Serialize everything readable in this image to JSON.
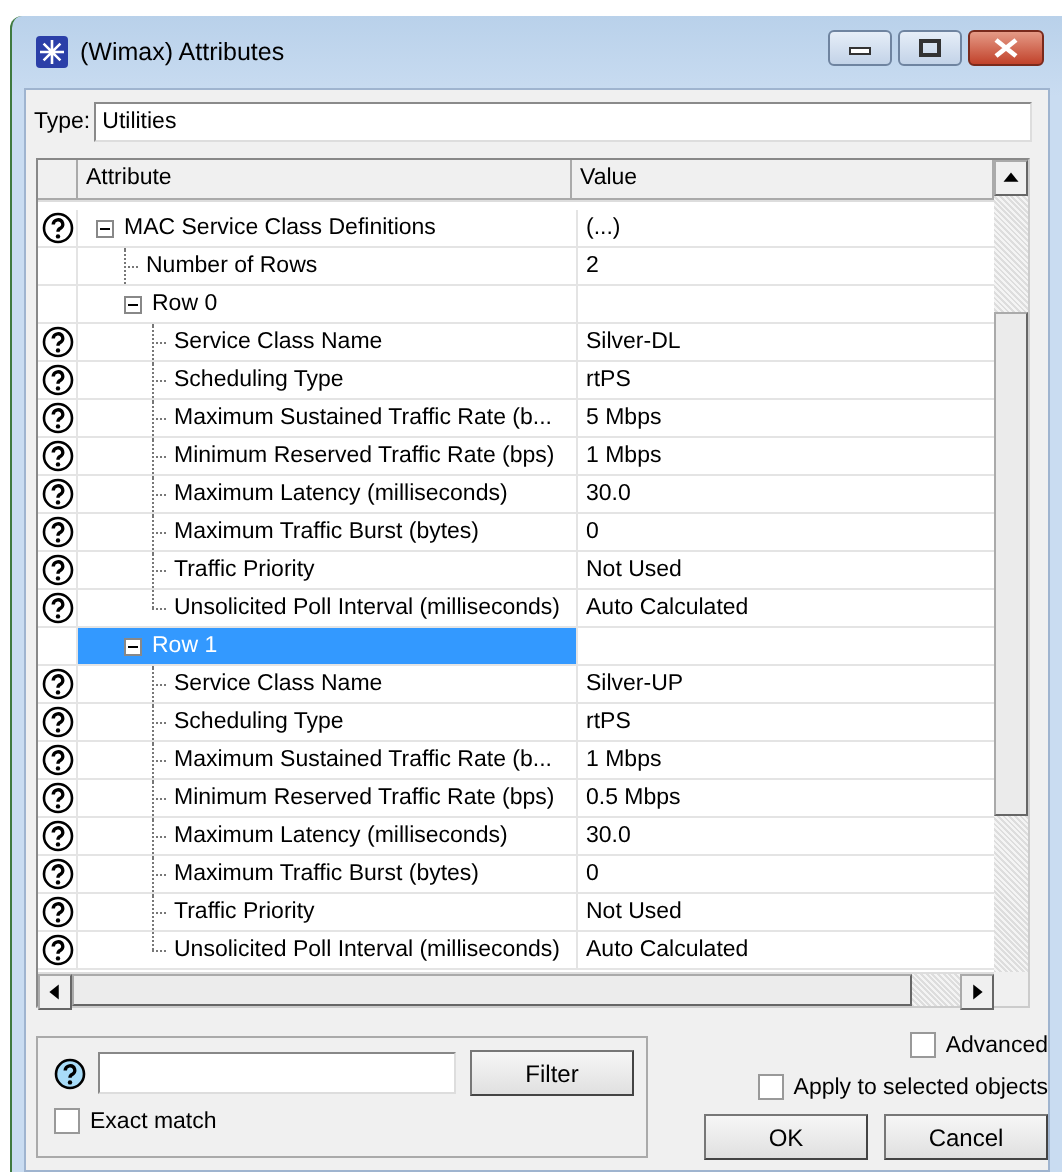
{
  "window": {
    "title": "(Wimax) Attributes"
  },
  "type_field": {
    "label": "Type:",
    "value": "Utilities"
  },
  "table": {
    "columns": [
      "Attribute",
      "Value"
    ],
    "rows": [
      {
        "attribute": "MAC Service Class Definitions",
        "value": "(...)",
        "help": true,
        "expanded": true,
        "selected": false,
        "children": [
          {
            "attribute": "Number of Rows",
            "value": "2",
            "help": false,
            "selected": false
          },
          {
            "attribute": "Row 0",
            "help": false,
            "expanded": true,
            "selected": false,
            "children": [
              {
                "attribute": "Service Class Name",
                "value": "Silver-DL",
                "help": true,
                "selected": false
              },
              {
                "attribute": "Scheduling Type",
                "value": "rtPS",
                "help": true,
                "selected": false
              },
              {
                "attribute": "Maximum Sustained Traffic Rate (b...",
                "value": "5 Mbps",
                "help": true,
                "selected": false
              },
              {
                "attribute": "Minimum Reserved Traffic Rate (bps)",
                "value": "1 Mbps",
                "help": true,
                "selected": false
              },
              {
                "attribute": "Maximum Latency (milliseconds)",
                "value": "30.0",
                "help": true,
                "selected": false
              },
              {
                "attribute": "Maximum Traffic Burst (bytes)",
                "value": "0",
                "help": true,
                "selected": false
              },
              {
                "attribute": "Traffic Priority",
                "value": "Not Used",
                "help": true,
                "selected": false
              },
              {
                "attribute": "Unsolicited Poll Interval (milliseconds)",
                "value": "Auto Calculated",
                "help": true,
                "selected": false
              }
            ]
          },
          {
            "attribute": "Row 1",
            "help": false,
            "expanded": true,
            "selected": true,
            "children": [
              {
                "attribute": "Service Class Name",
                "value": "Silver-UP",
                "help": true,
                "selected": false
              },
              {
                "attribute": "Scheduling Type",
                "value": "rtPS",
                "help": true,
                "selected": false
              },
              {
                "attribute": "Maximum Sustained Traffic Rate (b...",
                "value": "1 Mbps",
                "help": true,
                "selected": false
              },
              {
                "attribute": "Minimum Reserved Traffic Rate (bps)",
                "value": "0.5 Mbps",
                "help": true,
                "selected": false
              },
              {
                "attribute": "Maximum Latency (milliseconds)",
                "value": "30.0",
                "help": true,
                "selected": false
              },
              {
                "attribute": "Maximum Traffic Burst (bytes)",
                "value": "0",
                "help": true,
                "selected": false
              },
              {
                "attribute": "Traffic Priority",
                "value": "Not Used",
                "help": true,
                "selected": false
              },
              {
                "attribute": "Unsolicited Poll Interval (milliseconds)",
                "value": "Auto Calculated",
                "help": true,
                "selected": false
              }
            ]
          }
        ]
      }
    ]
  },
  "filter": {
    "button": "Filter",
    "exact_match": {
      "label": "Exact match",
      "checked": false
    }
  },
  "options": [
    {
      "label": "Advanced",
      "checked": false
    },
    {
      "label": "Apply to selected objects",
      "checked": false
    }
  ],
  "buttons": [
    {
      "label": "OK"
    },
    {
      "label": "Cancel"
    }
  ]
}
